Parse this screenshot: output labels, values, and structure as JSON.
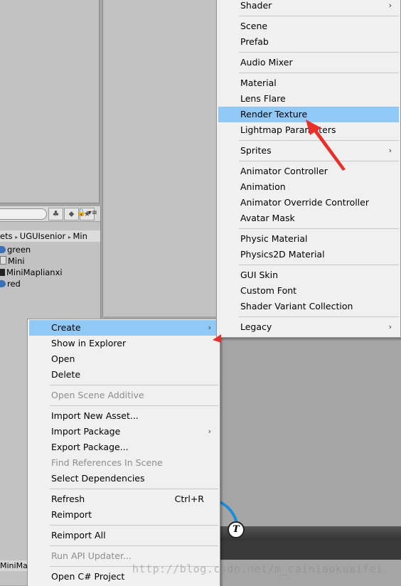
{
  "project": {
    "breadcrumb": [
      "ets",
      "UGUIsenior",
      "Min"
    ],
    "files": [
      {
        "name": "green",
        "icon": "material-sphere-icon"
      },
      {
        "name": "Mini",
        "icon": "render-texture-icon"
      },
      {
        "name": "MiniMaplianxi",
        "icon": "unity-scene-icon"
      },
      {
        "name": "red",
        "icon": "material-sphere-icon"
      }
    ],
    "bottom_tab": "MiniMap"
  },
  "context_menu": {
    "items": [
      {
        "label": "Create",
        "highlight": true,
        "submenu": true
      },
      {
        "label": "Show in Explorer"
      },
      {
        "label": "Open"
      },
      {
        "label": "Delete"
      },
      {
        "label": "Open Scene Additive",
        "disabled": true
      },
      {
        "label": "Import New Asset..."
      },
      {
        "label": "Import Package",
        "submenu": true
      },
      {
        "label": "Export Package..."
      },
      {
        "label": "Find References In Scene",
        "disabled": true
      },
      {
        "label": "Select Dependencies"
      },
      {
        "label": "Refresh",
        "shortcut": "Ctrl+R"
      },
      {
        "label": "Reimport"
      },
      {
        "label": "Reimport All"
      },
      {
        "label": "Run API Updater...",
        "disabled": true
      },
      {
        "label": "Open C# Project"
      }
    ]
  },
  "create_submenu": {
    "items": [
      {
        "label": "Shader",
        "submenu": true
      },
      {
        "label": "Scene"
      },
      {
        "label": "Prefab"
      },
      {
        "label": "Audio Mixer"
      },
      {
        "label": "Material"
      },
      {
        "label": "Lens Flare"
      },
      {
        "label": "Render Texture",
        "highlight": true
      },
      {
        "label": "Lightmap Parameters"
      },
      {
        "label": "Sprites",
        "submenu": true
      },
      {
        "label": "Animator Controller"
      },
      {
        "label": "Animation"
      },
      {
        "label": "Animator Override Controller"
      },
      {
        "label": "Avatar Mask"
      },
      {
        "label": "Physic Material"
      },
      {
        "label": "Physics2D Material"
      },
      {
        "label": "GUI Skin"
      },
      {
        "label": "Custom Font"
      },
      {
        "label": "Shader Variant Collection"
      },
      {
        "label": "Legacy",
        "submenu": true
      }
    ]
  },
  "watermark": "http://blog.csdn.net/m_cainiaokuaifei",
  "colors": {
    "highlight": "#90c8f6",
    "annotation_arrow": "#e8302a",
    "menu_bg": "#f0f0f0"
  }
}
